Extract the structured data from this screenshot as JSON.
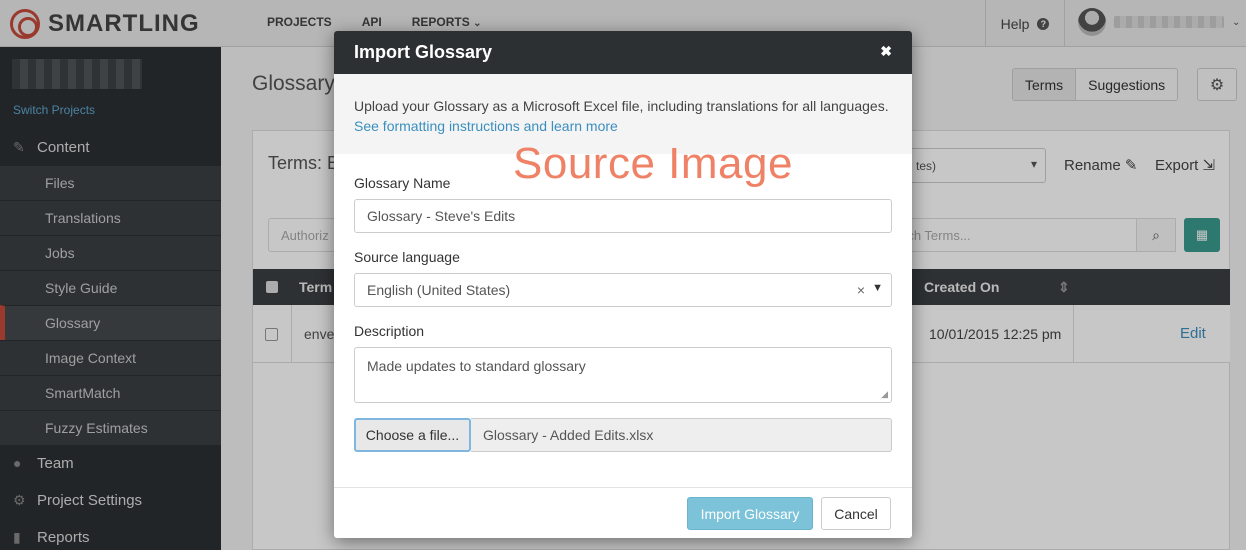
{
  "app": {
    "brand": "SMARTLING"
  },
  "nav": {
    "projects": "PROJECTS",
    "api": "API",
    "reports": "REPORTS"
  },
  "topbar": {
    "help": "Help"
  },
  "sidebar": {
    "switch_projects": "Switch Projects",
    "content": "Content",
    "items": [
      "Files",
      "Translations",
      "Jobs",
      "Style Guide",
      "Glossary",
      "Image Context",
      "SmartMatch",
      "Fuzzy Estimates"
    ],
    "team": "Team",
    "project_settings": "Project Settings",
    "reports": "Reports"
  },
  "page": {
    "title": "Glossary",
    "tabs": [
      "Terms",
      "Suggestions"
    ],
    "terms_label": "Terms: E",
    "language_select": "tes)",
    "rename": "Rename",
    "export": "Export",
    "author_placeholder": "Authoriz",
    "search_placeholder": "rch Terms...",
    "columns": {
      "term": "Term",
      "created_on": "Created On"
    },
    "row": {
      "term": "enve",
      "created_on": "10/01/2015 12:25 pm",
      "edit": "Edit"
    }
  },
  "modal": {
    "title": "Import Glossary",
    "intro": "Upload your Glossary as a Microsoft Excel file, including translations for all languages.",
    "link": "See formatting instructions and learn more",
    "watermark": "Source Image",
    "name_label": "Glossary Name",
    "name_value": "Glossary - Steve's Edits",
    "source_label": "Source language",
    "source_value": "English (United States)",
    "description_label": "Description",
    "description_value": "Made updates to standard glossary",
    "choose_file": "Choose a file...",
    "file_name": "Glossary - Added Edits.xlsx",
    "import_button": "Import Glossary",
    "cancel_button": "Cancel"
  },
  "colors": {
    "accent": "#c64a3a",
    "sidebar": "#2c3033",
    "primary_button": "#7cc3d9",
    "link": "#3a8fbf"
  }
}
